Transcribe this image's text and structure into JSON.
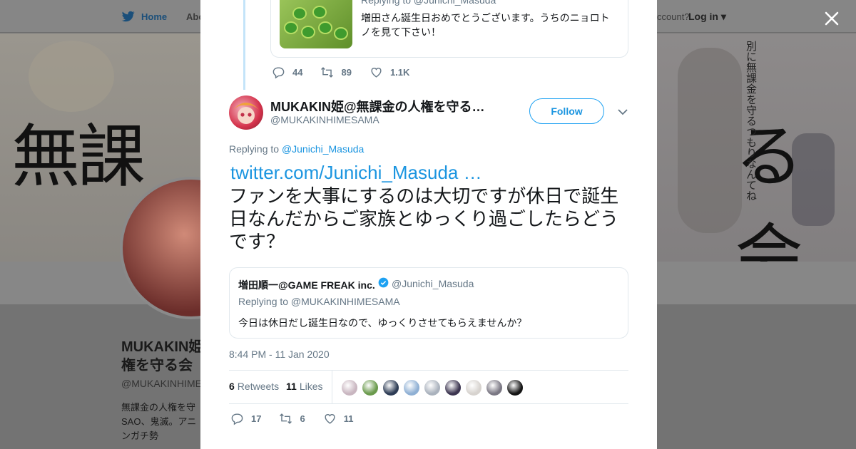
{
  "background": {
    "nav": {
      "home": "Home",
      "about": "Abo",
      "account": "ccount?",
      "login": "Log in"
    },
    "banner": {
      "left_text": "無課",
      "right_text": "る会",
      "vertical": "別に無課金を守るつもりなんてね"
    },
    "profile": {
      "name_line1": "MUKAKIN姫",
      "name_line2": "権を守る会",
      "handle": "@MUKAKINHIME",
      "bio_line1": "無課金の人権を守",
      "bio_line2": "SAO、鬼滅。アニ",
      "bio_line3": "ンガチ勢"
    }
  },
  "previous_tweet": {
    "replying": "Replying to @Junichi_Masuda",
    "text": "増田さん誕生日おめでとうございます。うちのニョロトノを見て下さい！",
    "replies": "44",
    "retweets": "89",
    "likes": "1.1K"
  },
  "tweet": {
    "author_name": "MUKAKIN姫@無課金の人権を守る…",
    "author_handle": "@MUKAKINHIMESAMA",
    "follow_label": "Follow",
    "replying_prefix": "Replying to",
    "replying_handle": "@Junichi_Masuda",
    "link": "twitter.com/Junichi_Masuda …",
    "text": "ファンを大事にするのは大切ですが休日で誕生日なんだからご家族とゆっくり過ごしたらどうです？",
    "quote": {
      "author_name": "増田順一@GAME FREAK inc.",
      "author_handle": "@Junichi_Masuda",
      "replying": "Replying to @MUKAKINHIMESAMA",
      "text": "今日は休日だし誕生日なので、ゆっくりさせてもらえませんか？"
    },
    "timestamp": "8:44 PM - 11 Jan 2020",
    "retweet_count": "6",
    "retweet_label": "Retweets",
    "like_count": "11",
    "like_label": "Likes",
    "replies": "17",
    "retweets": "6",
    "likes": "11"
  },
  "colors": {
    "link": "#1b95e0",
    "secondary": "#657786",
    "border": "#e1e8ed",
    "thread": "#c4e4f9"
  },
  "likers": [
    "#c9b6c0",
    "#6a9a4c",
    "#2d3c55",
    "#8fb0d4",
    "#aab2bd",
    "#3c3550",
    "#d7d3cf",
    "#7a7783",
    "#141414"
  ]
}
